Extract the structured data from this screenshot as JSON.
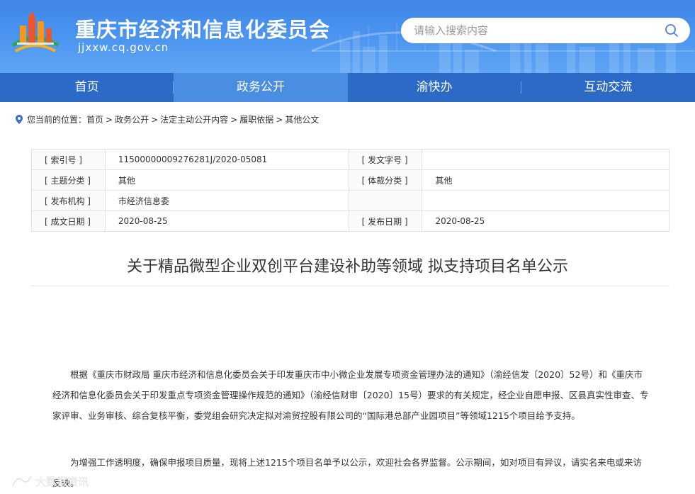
{
  "header": {
    "site_title": "重庆市经济和信息化委员会",
    "site_domain": "jjxxw.cq.gov.cn",
    "search_placeholder": "请输入搜索内容",
    "brand_color": "#3f86e6"
  },
  "nav": {
    "items": [
      {
        "label": "首页"
      },
      {
        "label": "政务公开"
      },
      {
        "label": "渝快办"
      },
      {
        "label": "互动交流"
      }
    ],
    "active_index": 1
  },
  "breadcrumb": {
    "prefix": "您当前的位置：",
    "items": [
      "首页",
      "政务公开",
      "法定主动公开内容",
      "履职依据",
      "其他公文"
    ],
    "separator": ">"
  },
  "info": {
    "rows": [
      {
        "label1": "[ 索引号 ]",
        "value1": "11500000009276281J/2020-05081",
        "label2": "[ 发文字号 ]",
        "value2": ""
      },
      {
        "label1": "[ 主题分类 ]",
        "value1": "其他",
        "label2": "[ 体裁分类 ]",
        "value2": "其他"
      },
      {
        "label1": "[ 发布机构 ]",
        "value1": "市经济信息委",
        "label2": "",
        "value2": ""
      },
      {
        "label1": "[ 成文日期 ]",
        "value1": "2020-08-25",
        "label2": "[ 发布日期 ]",
        "value2": "2020-08-25"
      }
    ]
  },
  "article": {
    "title": "关于精品微型企业双创平台建设补助等领域 拟支持项目名单公示",
    "paragraphs": [
      "根据《重庆市财政局 重庆市经济和信息化委员会关于印发重庆市中小微企业发展专项资金管理办法的通知》（渝经信发〔2020〕52号）和《重庆市经济和信息化委员会关于印发重点专项资金管理操作规范的通知》（渝经信财审〔2020〕15号）要求的有关规定，经企业自愿申报、区县真实性审查、专家评审、业务审核、综合复核平衡，委党组会研究决定拟对渝贸控股有限公司的“国际港总部产业园项目”等领域1215个项目给予支持。",
      "为增强工作透明度，确保申报项目质量，现将上述1215个项目名单予以公示，欢迎社会各界监督。公示期间，如对项目有异议，请实名来电或来访反映。"
    ]
  },
  "watermark": {
    "text": "大数据资讯"
  }
}
